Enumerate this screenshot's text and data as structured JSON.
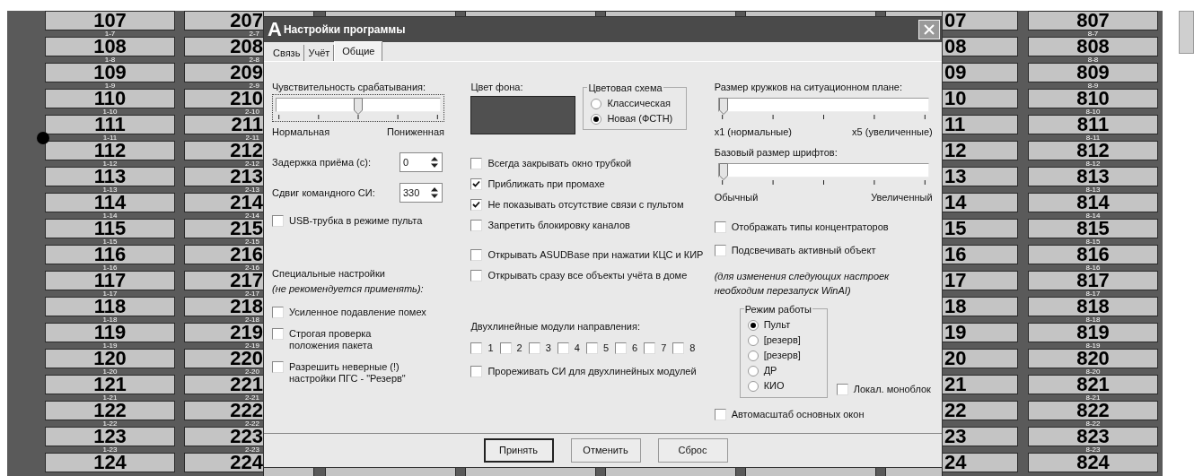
{
  "grid": {
    "columns": [
      {
        "kind": "full",
        "cells": [
          {
            "number": "107",
            "sublabel": "1-7"
          },
          {
            "number": "108",
            "sublabel": "1-8"
          },
          {
            "number": "109",
            "sublabel": "1-9"
          },
          {
            "number": "110",
            "sublabel": "1-10"
          },
          {
            "number": "111",
            "sublabel": "1-11"
          },
          {
            "number": "112",
            "sublabel": "1-12"
          },
          {
            "number": "113",
            "sublabel": "1-13"
          },
          {
            "number": "114",
            "sublabel": "1-14"
          },
          {
            "number": "115",
            "sublabel": "1-15"
          },
          {
            "number": "116",
            "sublabel": "1-16"
          },
          {
            "number": "117",
            "sublabel": "1-17"
          },
          {
            "number": "118",
            "sublabel": "1-18"
          },
          {
            "number": "119",
            "sublabel": "1-19"
          },
          {
            "number": "120",
            "sublabel": "1-20"
          },
          {
            "number": "121",
            "sublabel": "1-21"
          },
          {
            "number": "122",
            "sublabel": "1-22"
          },
          {
            "number": "123",
            "sublabel": "1-23"
          },
          {
            "number": "124"
          }
        ]
      },
      {
        "kind": "cut-right",
        "cells": [
          {
            "number": "207",
            "sublabel": "2-7"
          },
          {
            "number": "208",
            "sublabel": "2-8"
          },
          {
            "number": "209",
            "sublabel": "2-9"
          },
          {
            "number": "210",
            "sublabel": "2-10"
          },
          {
            "number": "211",
            "sublabel": "2-11"
          },
          {
            "number": "212",
            "sublabel": "2-12"
          },
          {
            "number": "213",
            "sublabel": "2-13"
          },
          {
            "number": "214",
            "sublabel": "2-14"
          },
          {
            "number": "215",
            "sublabel": "2-15"
          },
          {
            "number": "216",
            "sublabel": "2-16"
          },
          {
            "number": "217",
            "sublabel": "2-17"
          },
          {
            "number": "218",
            "sublabel": "2-18"
          },
          {
            "number": "219",
            "sublabel": "2-19"
          },
          {
            "number": "220",
            "sublabel": "2-20"
          },
          {
            "number": "221",
            "sublabel": "2-21"
          },
          {
            "number": "222",
            "sublabel": "2-22"
          },
          {
            "number": "223",
            "sublabel": "2-23"
          },
          {
            "number": "224"
          }
        ]
      },
      {
        "kind": "cut-left",
        "cells": [
          {
            "number": "07"
          },
          {
            "number": "08"
          },
          {
            "number": "09"
          },
          {
            "number": "10"
          },
          {
            "number": "11"
          },
          {
            "number": "12"
          },
          {
            "number": "13"
          },
          {
            "number": "14"
          },
          {
            "number": "15"
          },
          {
            "number": "16"
          },
          {
            "number": "17"
          },
          {
            "number": "18"
          },
          {
            "number": "19"
          },
          {
            "number": "20"
          },
          {
            "number": "21"
          },
          {
            "number": "22"
          },
          {
            "number": "23"
          },
          {
            "number": "24"
          }
        ]
      },
      {
        "kind": "full",
        "cells": [
          {
            "number": "807",
            "sublabel": "8-7"
          },
          {
            "number": "808",
            "sublabel": "8-8"
          },
          {
            "number": "809",
            "sublabel": "8-9"
          },
          {
            "number": "810",
            "sublabel": "8-10"
          },
          {
            "number": "811",
            "sublabel": "8-11"
          },
          {
            "number": "812",
            "sublabel": "8-12"
          },
          {
            "number": "813",
            "sublabel": "8-13"
          },
          {
            "number": "814",
            "sublabel": "8-14"
          },
          {
            "number": "815",
            "sublabel": "8-15"
          },
          {
            "number": "816",
            "sublabel": "8-16"
          },
          {
            "number": "817",
            "sublabel": "8-17"
          },
          {
            "number": "818",
            "sublabel": "8-18"
          },
          {
            "number": "819",
            "sublabel": "8-19"
          },
          {
            "number": "820",
            "sublabel": "8-20"
          },
          {
            "number": "821",
            "sublabel": "8-21"
          },
          {
            "number": "822",
            "sublabel": "8-22"
          },
          {
            "number": "823",
            "sublabel": "8-23"
          },
          {
            "number": "824"
          }
        ]
      }
    ]
  },
  "window": {
    "logo": "A",
    "title": "Настройки программы"
  },
  "tabs": [
    {
      "label": "Связь",
      "selected": false
    },
    {
      "label": "Учёт",
      "selected": false
    },
    {
      "label": "Общие",
      "selected": true
    }
  ],
  "general": {
    "sensitivity": {
      "label": "Чувствительность срабатывания:",
      "level": 0.5,
      "focused": true,
      "min_label": "Нормальная",
      "max_label": "Пониженная"
    },
    "delay": {
      "label": "Задержка приёма (с):",
      "value": "0"
    },
    "shift": {
      "label": "Сдвиг командного СИ:",
      "value": "330"
    },
    "usb_handset": {
      "label": "USB-трубка в режиме пульта",
      "checked": false
    },
    "special": {
      "title": "Специальные настройки",
      "note": "(не рекомендуется применять):",
      "options": [
        {
          "label": "Усиленное подавление помех",
          "checked": false
        },
        {
          "label": "Строгая проверка\nположения пакета",
          "checked": false
        },
        {
          "label": "Разрешить неверные (!)\nнастройки ПГС - \"Резерв\"",
          "checked": false
        }
      ]
    },
    "background_color": {
      "label": "Цвет фона:"
    },
    "color_scheme": {
      "title": "Цветовая схема",
      "options": [
        {
          "label": "Классическая",
          "selected": false
        },
        {
          "label": "Новая (ФСТН)",
          "selected": true
        }
      ]
    },
    "options": [
      {
        "label": "Всегда закрывать окно трубкой",
        "checked": false
      },
      {
        "label": "Приближать при промахе",
        "checked": true
      },
      {
        "label": "Не показывать отсутствие связи с пультом",
        "checked": true
      },
      {
        "label": "Запретить блокировку каналов",
        "checked": false
      },
      {
        "label": "Открывать ASUDBase при нажатии КЦС и КИР",
        "checked": false
      },
      {
        "label": "Открывать сразу все объекты учёта в доме",
        "checked": false
      }
    ],
    "two_line_modules": {
      "label": "Двухлинейные модули направления:",
      "channels": [
        {
          "label": "1",
          "checked": false
        },
        {
          "label": "2",
          "checked": false
        },
        {
          "label": "3",
          "checked": false
        },
        {
          "label": "4",
          "checked": false
        },
        {
          "label": "5",
          "checked": false
        },
        {
          "label": "6",
          "checked": false
        },
        {
          "label": "7",
          "checked": false
        },
        {
          "label": "8",
          "checked": false
        }
      ]
    },
    "thin_out": {
      "label": "Прореживать СИ для двухлинейных модулей",
      "checked": false
    },
    "circle_size": {
      "label": "Размер кружков на ситуационном плане:",
      "level": 0,
      "focused": false,
      "min_label": "x1 (нормальные)",
      "max_label": "x5 (увеличенные)"
    },
    "font_size": {
      "label": "Базовый размер шрифтов:",
      "level": 0,
      "focused": false,
      "min_label": "Обычный",
      "max_label": "Увеличенный"
    },
    "display_options": [
      {
        "label": "Отображать типы концентраторов",
        "checked": false
      },
      {
        "label": "Подсвечивать активный объект",
        "checked": false
      }
    ],
    "restart_note": "(для изменения следующих настроек\nнеобходим перезапуск WinAI)",
    "mode": {
      "title": "Режим работы",
      "options": [
        {
          "label": "Пульт",
          "selected": true
        },
        {
          "label": "[резерв]",
          "selected": false
        },
        {
          "label": "[резерв]",
          "selected": false
        },
        {
          "label": "ДР",
          "selected": false
        },
        {
          "label": "КИО",
          "selected": false
        }
      ]
    },
    "local_monoblock": {
      "label": "Локал. моноблок",
      "checked": false
    },
    "autoscale": {
      "label": "Автомасштаб основных окон",
      "checked": false
    }
  },
  "buttons": [
    {
      "label": "Принять",
      "default": true
    },
    {
      "label": "Отменить",
      "default": false
    },
    {
      "label": "Сброс",
      "default": false
    }
  ]
}
